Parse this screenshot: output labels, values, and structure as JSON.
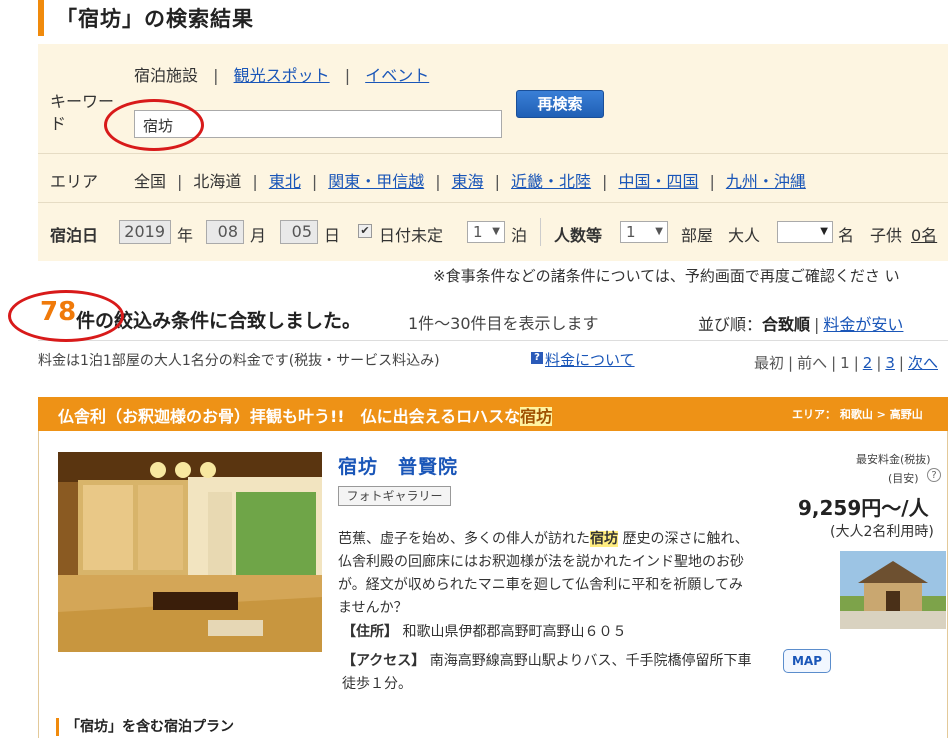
{
  "page": {
    "title": "「宿坊」の検索結果"
  },
  "search": {
    "tabs": {
      "active": "宿泊施設",
      "spots": "観光スポット",
      "events": "イベント"
    },
    "keyword_label": "キーワード",
    "keyword_value": "宿坊",
    "research_button": "再検索",
    "area_label": "エリア",
    "areas": [
      "全国",
      "北海道",
      "東北",
      "関東・甲信越",
      "東海",
      "近畿・北陸",
      "中国・四国",
      "九州・沖縄"
    ],
    "date_label": "宿泊日",
    "year": "2019",
    "year_unit": "年",
    "month": "08",
    "month_unit": "月",
    "day": "05",
    "day_unit": "日",
    "checkbox_mark": "✔",
    "date_undecided": "日付未定",
    "nights": "1",
    "nights_unit": "泊",
    "people_label": "人数等",
    "rooms": "1",
    "rooms_unit": "部屋",
    "adult_label": "大人",
    "adult_unit": "名",
    "child_label": "子供",
    "child_value": "0名"
  },
  "notice": "※食事条件などの諸条件については、予約画面で再度ご確認くださ い",
  "results": {
    "count": "78",
    "match_text": "件の絞込み条件に合致しました。",
    "range_text": "1件～30件目を表示します",
    "sort_label": "並び順：",
    "sort_active": "合致順",
    "sort_price": "料金が安い",
    "price_note": "料金は1泊1部屋の大人1名分の料金です(税抜・サービス料込み)",
    "price_about": "料金について",
    "pager": {
      "first": "最初",
      "prev": "前へ",
      "pages": [
        "1",
        "2",
        "3"
      ],
      "next": "次へ"
    }
  },
  "listing": {
    "catch": "仏舎利（お釈迦様のお骨）拝観も叶う!!　仏に出会えるロハスな",
    "catch_highlight": "宿坊",
    "area": "エリア： 和歌山 > 高野山",
    "name": "宿坊　普賢院",
    "gallery": "フォトギャラリー",
    "desc_before": "芭蕉、虚子を始め、多くの俳人が訪れた",
    "desc_highlight": "宿坊",
    "desc_after": "歴史の深さに触れ、仏舎利殿の回廊床にはお釈迦様が法を説かれたインド聖地のお砂が。経文が収められたマニ車を廻して仏舎利に平和を祈願してみませんか？",
    "address_label": "【住所】",
    "address": "和歌山県伊都郡高野町高野山６０５",
    "access_label": "【アクセス】",
    "access": "南海高野線高野山駅よりバス、千手院橋停留所下車徒歩１分。",
    "map_button": "MAP",
    "price_label": "最安料金(税抜)",
    "price_sub": "(目安)",
    "help_mark": "?",
    "price": "9,259円～/人",
    "price_note": "(大人2名利用時)"
  },
  "plan_heading": "「宿坊」を含む宿泊プラン",
  "colors": {
    "accent": "#f08a0c",
    "link": "#1a56b8",
    "header_bar": "#ee9216",
    "panel": "#fdf5e1",
    "annotation": "#d81a1a"
  }
}
